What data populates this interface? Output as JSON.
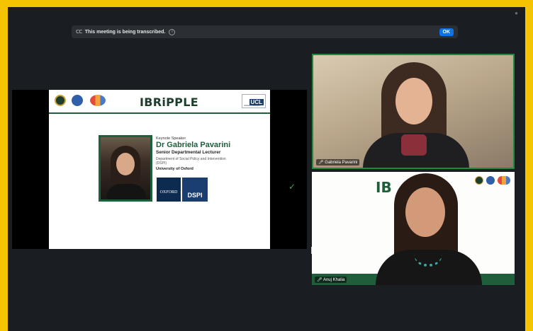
{
  "banner": {
    "cc_label": "CC",
    "text": "This meeting is being transcribed.",
    "info_icon": "i",
    "ok_label": "OK"
  },
  "slide": {
    "brand": "IBRiPPLE",
    "ucl_label": "UCL",
    "ucl_caption": "Institute of Education",
    "keynote_label": "Keynote Speaker",
    "speaker_name": "Dr Gabriela Pavarini",
    "speaker_role": "Senior Departmental Lecturer",
    "department": "Department of Social Policy and Intervention (DSPI)",
    "university": "University of Oxford",
    "oxford_label": "OXFORD",
    "dspi_label": "DSPI"
  },
  "participants": [
    {
      "name": "Gabriela Pavarini",
      "active": true
    },
    {
      "name": "Anuj Khalia",
      "active": false
    }
  ],
  "colors": {
    "frame": "#f5c400",
    "accent_green": "#1f5e3a",
    "ok_blue": "#0e72ed"
  }
}
